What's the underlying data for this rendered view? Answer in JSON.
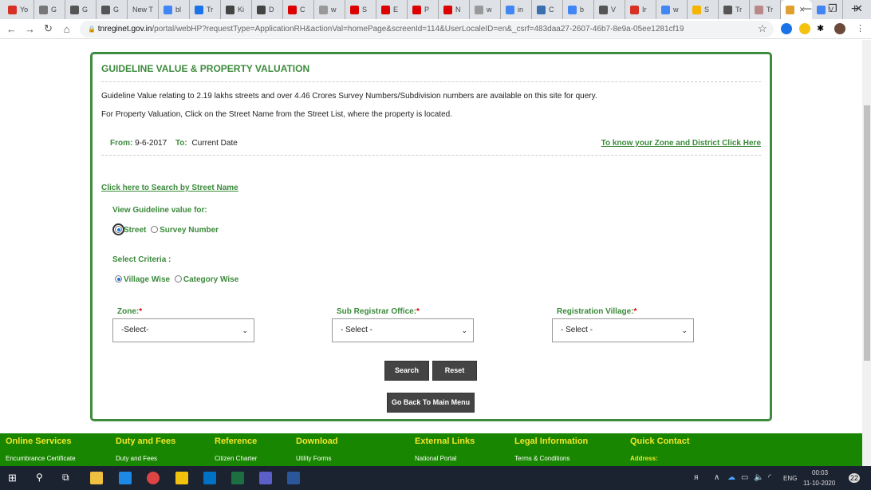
{
  "browser": {
    "tabs": [
      {
        "label": "Yo",
        "icon": "gmail-icon",
        "color": "#d93025"
      },
      {
        "label": "G",
        "icon": "emblem-icon",
        "color": "#777"
      },
      {
        "label": "G",
        "icon": "globe-icon",
        "color": "#555"
      },
      {
        "label": "G",
        "icon": "globe-icon",
        "color": "#555"
      },
      {
        "label": "New T",
        "icon": "",
        "color": ""
      },
      {
        "label": "bl",
        "icon": "google-icon",
        "color": "#4285f4"
      },
      {
        "label": "Tr",
        "icon": "play-icon",
        "color": "#1a73e8"
      },
      {
        "label": "Ki",
        "icon": "lock-icon",
        "color": "#444"
      },
      {
        "label": "D",
        "icon": "lock-icon",
        "color": "#444"
      },
      {
        "label": "C",
        "icon": "tmi-icon",
        "color": "#d00"
      },
      {
        "label": "w",
        "icon": "tmi-icon",
        "color": "#999"
      },
      {
        "label": "S",
        "icon": "tmi-icon",
        "color": "#d00"
      },
      {
        "label": "E",
        "icon": "tmi-icon",
        "color": "#d00"
      },
      {
        "label": "P",
        "icon": "tmi-icon",
        "color": "#d00"
      },
      {
        "label": "N",
        "icon": "tmi-icon",
        "color": "#d00"
      },
      {
        "label": "w",
        "icon": "tmi-icon",
        "color": "#999"
      },
      {
        "label": "in",
        "icon": "google-icon",
        "color": "#4285f4"
      },
      {
        "label": "C",
        "icon": "cloud-icon",
        "color": "#3a6fb0"
      },
      {
        "label": "b",
        "icon": "google-icon",
        "color": "#4285f4"
      },
      {
        "label": "V",
        "icon": "globe-icon",
        "color": "#555"
      },
      {
        "label": "Ir",
        "icon": "gmail-icon",
        "color": "#d93025"
      },
      {
        "label": "w",
        "icon": "google-icon",
        "color": "#4285f4"
      },
      {
        "label": "S",
        "icon": "chrome-icon",
        "color": "#f4b400"
      },
      {
        "label": "Tr",
        "icon": "globe-icon",
        "color": "#555"
      },
      {
        "label": "Tr",
        "icon": "image-icon",
        "color": "#b88"
      },
      {
        "label": "",
        "icon": "tn-emblem-icon",
        "color": "#e0a030",
        "active": true
      },
      {
        "label": "V",
        "icon": "google-icon",
        "color": "#4285f4"
      }
    ],
    "url_host": "tnreginet.gov.in",
    "url_rest": "/portal/webHP?requestType=ApplicationRH&actionVal=homePage&screenId=114&UserLocaleID=en&_csrf=483daa27-2607-46b7-8e9a-05ee1281cf19"
  },
  "panel": {
    "title": "GUIDELINE VALUE & PROPERTY VALUATION",
    "line1": "Guideline Value relating to 2.19 lakhs streets and over 4.46 Crores Survey Numbers/Subdivision numbers are available on this site for query.",
    "line2": "For Property Valuation, Click on the Street Name from the Street List, where the property is located.",
    "from_label": "From:",
    "from_value": "9-6-2017",
    "to_label": "To:",
    "to_value": "Current Date",
    "zone_link": "To know your Zone and District Click Here",
    "street_link": "Click here to Search by Street Name",
    "view_label": "View Guideline value for:",
    "view_options": [
      {
        "label": "Street",
        "selected": true
      },
      {
        "label": "Survey Number",
        "selected": false
      }
    ],
    "criteria_label": "Select Criteria :",
    "criteria_options": [
      {
        "label": "Village Wise",
        "selected": true
      },
      {
        "label": "Category Wise",
        "selected": false
      }
    ],
    "zone": {
      "label": "Zone:",
      "value": "-Select-"
    },
    "sro": {
      "label": "Sub Registrar Office:",
      "value": "- Select -"
    },
    "village": {
      "label": "Registration Village:",
      "value": "- Select -"
    },
    "required_mark": "*",
    "search": "Search",
    "reset": "Reset",
    "back": "Go Back To Main Menu"
  },
  "footer": {
    "columns": [
      {
        "title": "Online Services",
        "item": "Encumbrance Certificate"
      },
      {
        "title": "Duty and Fees",
        "item": "Duty and Fees"
      },
      {
        "title": "Reference",
        "item": "Citizen Charter"
      },
      {
        "title": "Download",
        "item": "Utility Forms"
      },
      {
        "title": "External Links",
        "item": "National Portal"
      },
      {
        "title": "Legal Information",
        "item": "Terms & Conditions"
      },
      {
        "title": "Quick Contact",
        "item": "Address:"
      }
    ]
  },
  "taskbar": {
    "lang": "ENG",
    "time": "00:03",
    "date": "11-10-2020",
    "notifications": "22"
  },
  "colors": {
    "accent_green": "#3b8a3b",
    "footer_green": "#188600",
    "footer_title": "#f2e62a"
  }
}
